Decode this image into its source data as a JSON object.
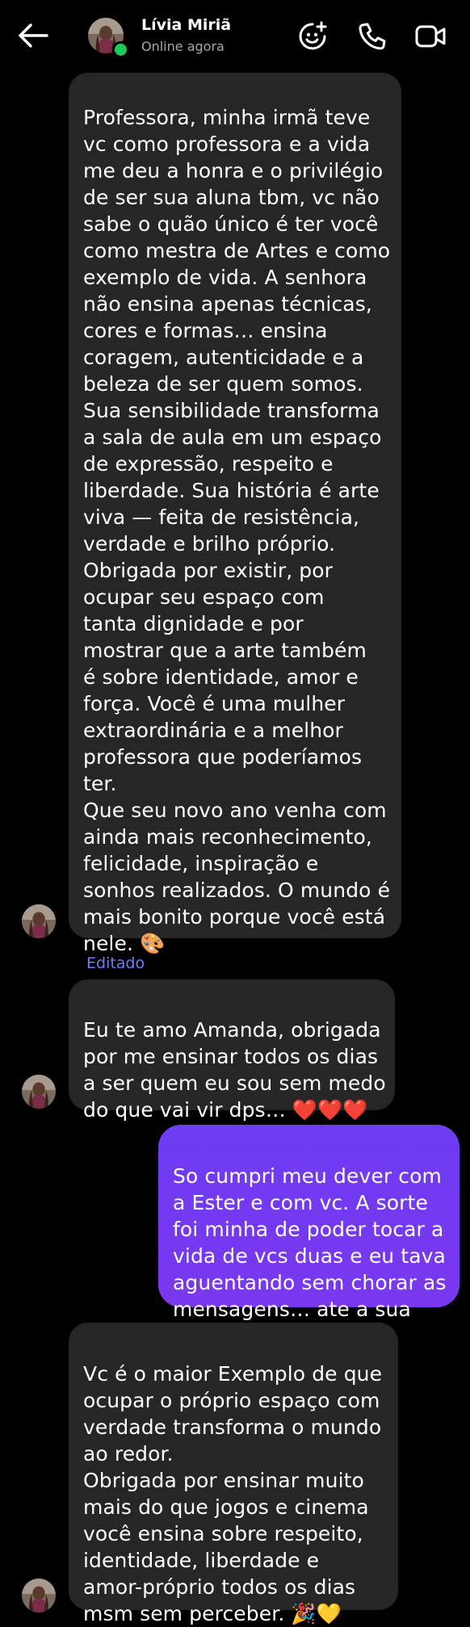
{
  "header": {
    "contact_name": "Lívia Miriã",
    "status": "Online agora",
    "icons": [
      "back-arrow-icon",
      "sticker-add-icon",
      "phone-icon",
      "video-camera-icon"
    ]
  },
  "colors": {
    "background": "#000000",
    "incoming_bubble": "#262626",
    "outgoing_bubble": "#7038f2",
    "online_dot": "#1ecb5a",
    "edited_label": "#6f7cff"
  },
  "messages": [
    {
      "direction": "incoming",
      "text": "Professora, minha irmã teve\nvc como professora e a vida\nme deu a honra e o privilégio\nde ser sua aluna tbm, vc não\nsabe o quão único é ter você\ncomo mestra de Artes e como\nexemplo de vida. A senhora\nnão ensina apenas técnicas,\ncores e formas… ensina\ncoragem, autenticidade e a\nbeleza de ser quem somos.\nSua sensibilidade transforma\na sala de aula em um espaço\nde expressão, respeito e\nliberdade. Sua história é arte\nviva — feita de resistência,\nverdade e brilho próprio.\nObrigada por existir, por\nocupar seu espaço com\ntanta dignidade e por\nmostrar que a arte também\né sobre identidade, amor e\nforça. Você é uma mulher\nextraordinária e a melhor\nprofessora que poderíamos\nter.\nQue seu novo ano venha com\nainda mais reconhecimento,\nfelicidade, inspiração e\nsonhos realizados. O mundo é\nmais bonito porque você está\nnele. 🎨"
    },
    {
      "direction": "incoming",
      "edited_label": "Editado",
      "text": "Eu te amo Amanda, obrigada\npor me ensinar todos os dias\na ser quem eu sou sem medo\ndo que vai vir dps… ",
      "emoji": "❤️❤️❤️"
    },
    {
      "direction": "outgoing",
      "text": "So cumpri meu dever com\na Ester e com vc. A sorte\nfoi minha de poder tocar a\nvida de vcs duas e eu tava\naguentando sem chorar as\nmensagens… ate a sua"
    },
    {
      "direction": "incoming",
      "text": "Vc é o maior Exemplo de que\nocupar o próprio espaço com\nverdade transforma o mundo\nao redor.\nObrigada por ensinar muito\nmais do que jogos e cinema\nvocê ensina sobre respeito,\nidentidade, liberdade e\namor-próprio todos os dias\nmsm sem perceber. 🎉💛"
    }
  ]
}
